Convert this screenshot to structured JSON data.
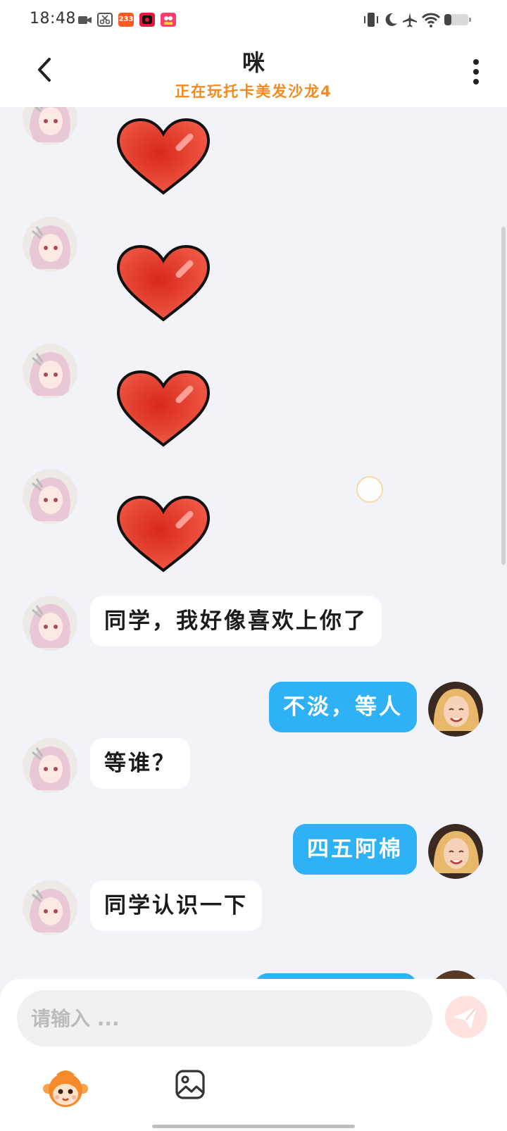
{
  "status_bar": {
    "time": "18:48",
    "left_icons": [
      "video-icon",
      "scissors-app-icon",
      "app-233-icon",
      "camera-app-icon",
      "game-app-icon"
    ],
    "app_233_label": "233",
    "right_icons": [
      "vibrate-icon",
      "moon-icon",
      "airplane-icon",
      "wifi-icon",
      "battery-icon"
    ],
    "battery_level": 0.28
  },
  "header": {
    "title": "咪",
    "subtitle": "正在玩托卡美发沙龙4",
    "subtitle_color": "#f28a22"
  },
  "messages": [
    {
      "side": "in",
      "type": "sticker",
      "sticker": "red-heart"
    },
    {
      "side": "in",
      "type": "sticker",
      "sticker": "red-heart"
    },
    {
      "side": "in",
      "type": "sticker",
      "sticker": "red-heart"
    },
    {
      "side": "in",
      "type": "sticker",
      "sticker": "red-heart"
    },
    {
      "side": "in",
      "type": "text",
      "text": "同学，我好像喜欢上你了"
    },
    {
      "side": "out",
      "type": "text",
      "text": "不淡，等人"
    },
    {
      "side": "in",
      "type": "text",
      "text": "等谁？"
    },
    {
      "side": "out",
      "type": "text",
      "text": "四五阿棉"
    },
    {
      "side": "in",
      "type": "text",
      "text": "同学认识一下"
    }
  ],
  "input": {
    "placeholder": "请输入 ..."
  },
  "colors": {
    "outgoing_bubble": "#2fb1f5",
    "incoming_bubble": "#ffffff",
    "send_button": "#ffb3ad"
  },
  "toolbar_icons": [
    "mascot-icon",
    "image-icon"
  ]
}
